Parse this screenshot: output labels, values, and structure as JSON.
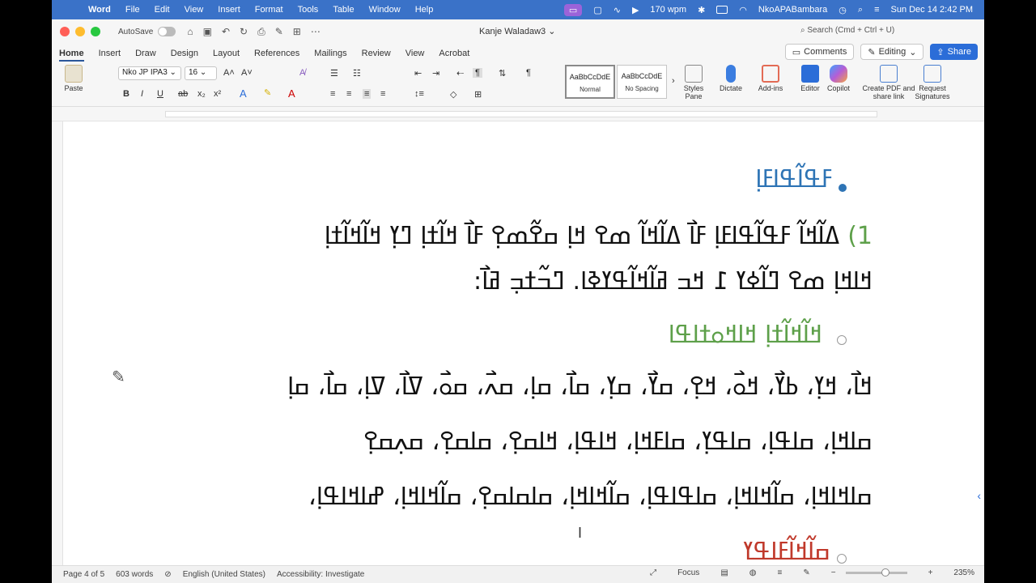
{
  "menubar": {
    "app_name": "Word",
    "items": [
      "File",
      "Edit",
      "View",
      "Insert",
      "Format",
      "Tools",
      "Table",
      "Window",
      "Help"
    ],
    "wpm": "170 wpm",
    "user": "NkoAPABambara",
    "datetime": "Sun Dec 14  2:42 PM"
  },
  "titlebar": {
    "autosave_label": "AutoSave",
    "doc_title": "Kanje Waladaw3",
    "search_placeholder": "Search (Cmd + Ctrl + U)"
  },
  "tabs": {
    "items": [
      "Home",
      "Insert",
      "Draw",
      "Design",
      "Layout",
      "References",
      "Mailings",
      "Review",
      "View",
      "Acrobat"
    ],
    "active": "Home",
    "comments_label": "Comments",
    "editing_label": "Editing",
    "share_label": "Share"
  },
  "ribbon": {
    "paste_label": "Paste",
    "font_name": "Nko JP IPA3",
    "font_size": "16",
    "style_normal_preview": "AaBbCcDdE",
    "style_normal_label": "Normal",
    "style_nospacing_preview": "AaBbCcDdE",
    "style_nospacing_label": "No Spacing",
    "styles_pane_label": "Styles Pane",
    "dictate_label": "Dictate",
    "addins_label": "Add-ins",
    "editor_label": "Editor",
    "copilot_label": "Copilot",
    "create_pdf_label": "Create PDF and share link",
    "request_sig_label": "Request Signatures"
  },
  "document": {
    "heading_blue": "ߓߟߊ߬ߟߊߓߊ߲",
    "para1_number": "1)",
    "para1_line1": "ߡߊ߬ߞߊ߬ ߓߟߊ߬ߟߊߓߊ߲ ߓߊ߯ ߡߊ߬ߞߊ߬ ߘߐ ߞߊ߲ ߛߐ߬ߘߐ߲ ߓߊ߯ ߞߊ߬ߙߊ߲ ߣߌ߲ ߞߊ߬ߞߊ߬ߙߊ߲",
    "para1_line2": "ߞߊߞߊ߲ ߘߐ ߣߊ߬ߦߌ ߁ ߞߏ ߥߊ߬ߞߊ߬ߟߌߢߊ. ߣߏ߬ߙߏ߲ ߥߊ߯:",
    "heading_green": "ߞߊ߬ߞߊ߬ߙߊ߲ ߞߊߞߋߙߊߟߊ",
    "row1": "ߞߊ߯، ߞߌ߲، ߕߌ߯، ߞߋ߯، ߞߐ߲، ߛߌ߯، ߛߌ߲، ߛߊ߯، ߛߊ߲، ߛߍ߯، ߛߋ߯، ߜߊ߯، ߜߊ߲، ߛߊ߯، ߛߊ߲",
    "row2": "ߛߊߞߊ߲، ߛߊߟߊ߲، ߛߊߟߌ߲، ߛߊߓߞߊ߲، ߞߊߟߊ߲، ߞߊߛߐ߲، ߛߊߛߐ߲، ߛߍ߲ߛߐ߲",
    "row3": "ߛߊߞߊߞߊ߲، ߛߊ߬ߞߊߞߊ߲، ߛߊߟߊߟߊ߲، ߛߊ߬ߞߊߞߊ߲، ߛߊߛߊߛߐ߲، ߛߊ߬ߞߊߞߊ߲، ߝߊߞߊߟߊ߲،",
    "heading_red": "ߛߊ߬ߞߊ߬ߓߊߟߌ"
  },
  "statusbar": {
    "page": "Page 4 of 5",
    "words": "603 words",
    "language": "English (United States)",
    "accessibility": "Accessibility: Investigate",
    "focus": "Focus",
    "zoom": "235%"
  },
  "colors": {
    "menubar_bg": "#3a72c8",
    "accent": "#2b579a",
    "heading_blue": "#2e74b5",
    "heading_green": "#5ea04a",
    "heading_red": "#c0392b"
  }
}
